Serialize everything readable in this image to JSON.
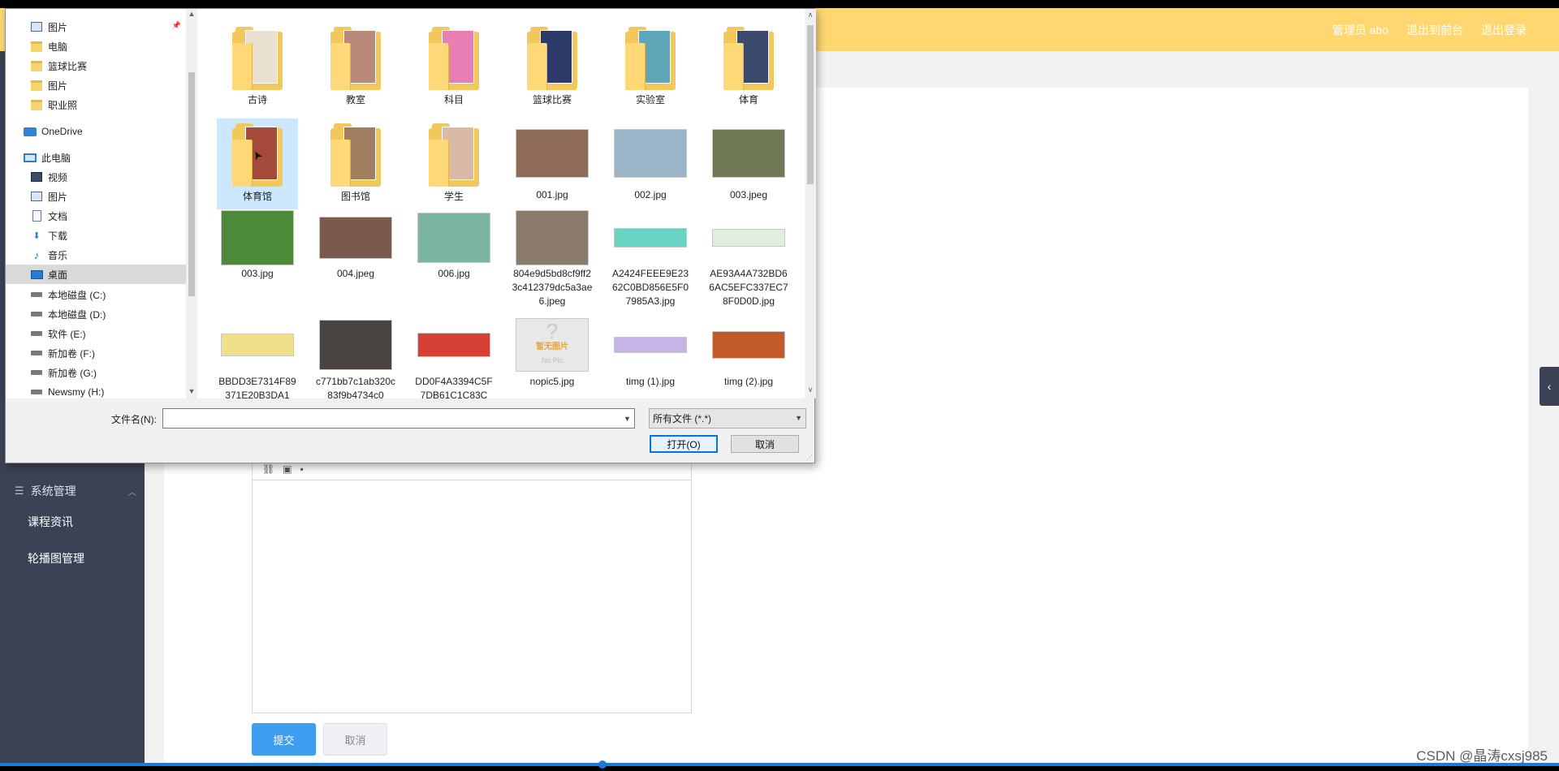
{
  "web": {
    "top_links": [
      "管理员 abo",
      "退出到前台",
      "退出登录"
    ],
    "sidebar_group": "系统管理",
    "sidebar_items": [
      "课程资讯",
      "轮播图管理"
    ],
    "submit": "提交",
    "cancel": "取消",
    "watermark": "CSDN @晶涛cxsj985"
  },
  "dialog": {
    "nav": [
      {
        "label": "图片",
        "icon": "picture-icon"
      },
      {
        "label": "电脑",
        "icon": "folder-icon"
      },
      {
        "label": "篮球比赛",
        "icon": "folder-icon"
      },
      {
        "label": "图片",
        "icon": "folder-icon"
      },
      {
        "label": "职业照",
        "icon": "folder-icon"
      },
      {
        "label": "OneDrive",
        "icon": "onedrive-icon"
      },
      {
        "label": "此电脑",
        "icon": "computer-icon"
      },
      {
        "label": "视频",
        "icon": "video-icon"
      },
      {
        "label": "图片",
        "icon": "picture-icon"
      },
      {
        "label": "文档",
        "icon": "document-icon"
      },
      {
        "label": "下载",
        "icon": "download-icon"
      },
      {
        "label": "音乐",
        "icon": "music-icon"
      },
      {
        "label": "桌面",
        "icon": "desktop-icon"
      },
      {
        "label": "本地磁盘 (C:)",
        "icon": "drive-icon"
      },
      {
        "label": "本地磁盘 (D:)",
        "icon": "drive-icon"
      },
      {
        "label": "软件 (E:)",
        "icon": "drive-icon"
      },
      {
        "label": "新加卷 (F:)",
        "icon": "drive-icon"
      },
      {
        "label": "新加卷 (G:)",
        "icon": "drive-icon"
      },
      {
        "label": "Newsmy (H:)",
        "icon": "drive-icon"
      }
    ],
    "files": [
      {
        "name": "古诗",
        "kind": "folder",
        "color": "#e9e2d2"
      },
      {
        "name": "教室",
        "kind": "folder",
        "color": "#b88a7a"
      },
      {
        "name": "科目",
        "kind": "folder",
        "color": "#e77fb4"
      },
      {
        "name": "篮球比赛",
        "kind": "folder",
        "color": "#2c3a6a"
      },
      {
        "name": "实验室",
        "kind": "folder",
        "color": "#5fa6b8"
      },
      {
        "name": "体育",
        "kind": "folder",
        "color": "#3b4a6a"
      },
      {
        "name": "体育馆",
        "kind": "folder",
        "color": "#a54a3a"
      },
      {
        "name": "图书馆",
        "kind": "folder",
        "color": "#a07e60"
      },
      {
        "name": "学生",
        "kind": "folder",
        "color": "#d9b9a8"
      },
      {
        "name": "001.jpg",
        "kind": "image",
        "color": "#8d6a5a",
        "w": 90,
        "h": 60
      },
      {
        "name": "002.jpg",
        "kind": "image",
        "color": "#9ab4c8",
        "w": 90,
        "h": 60
      },
      {
        "name": "003.jpeg",
        "kind": "image",
        "color": "#6f7a55",
        "w": 90,
        "h": 60
      },
      {
        "name": "003.jpg",
        "kind": "image",
        "color": "#4d8a3a",
        "w": 90,
        "h": 68
      },
      {
        "name": "004.jpeg",
        "kind": "image",
        "color": "#7a5a4a",
        "w": 90,
        "h": 52
      },
      {
        "name": "006.jpg",
        "kind": "image",
        "color": "#7bb7a0",
        "w": 90,
        "h": 62
      },
      {
        "name": "804e9d5bd8cf9ff23c412379dc5a3ae6.jpeg",
        "kind": "image",
        "color": "#8a7a6a",
        "w": 90,
        "h": 68
      },
      {
        "name": "A2424FEEE9E2362C0BD856E5F07985A3.jpg",
        "kind": "image",
        "color": "#6ad4c4",
        "w": 90,
        "h": 24
      },
      {
        "name": "AE93A4A732BD66AC5EFC337EC78F0D0D.jpg",
        "kind": "image",
        "color": "#dfeedd",
        "w": 90,
        "h": 22
      },
      {
        "name": "BBDD3E7314F89371E20B3DA1",
        "kind": "image",
        "color": "#f0e08a",
        "w": 90,
        "h": 28
      },
      {
        "name": "c771bb7c1ab320c83f9b4734c0",
        "kind": "image",
        "color": "#4a4440",
        "w": 90,
        "h": 62
      },
      {
        "name": "DD0F4A3394C5F7DB61C1C83C",
        "kind": "image",
        "color": "#d64034",
        "w": 90,
        "h": 30
      },
      {
        "name": "nopic5.jpg",
        "kind": "image",
        "color": "#e8e8e8",
        "w": 90,
        "h": 66,
        "caption": "暂无图片",
        "caption2": "No Pic"
      },
      {
        "name": "timg (1).jpg",
        "kind": "image",
        "color": "#c6b4e6",
        "w": 90,
        "h": 20
      },
      {
        "name": "timg (2).jpg",
        "kind": "image",
        "color": "#c25a2a",
        "w": 90,
        "h": 34
      }
    ],
    "filename_label": "文件名(N):",
    "filename_value": "",
    "filetype": "所有文件 (*.*)",
    "open": "打开(O)",
    "cancel": "取消"
  }
}
